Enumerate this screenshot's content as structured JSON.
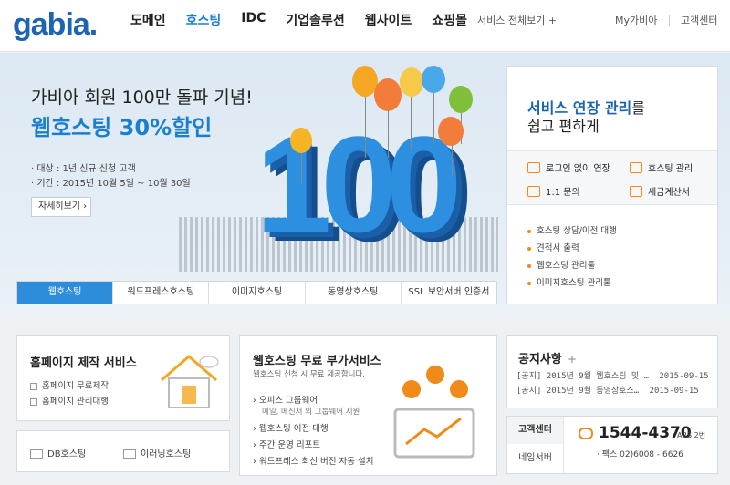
{
  "header": {
    "logo": "gabia.",
    "nav": [
      "도메인",
      "호스팅",
      "IDC",
      "기업솔루션",
      "웹사이트",
      "쇼핑몰"
    ],
    "active_nav": "호스팅",
    "service_all": "서비스 전체보기 +",
    "my_gabia": "My가비아",
    "customer_center": "고객센터"
  },
  "banner": {
    "subtitle": "가비아 회원 100만 돌파 기념!",
    "title": "웹호스팅 30%할인",
    "info": [
      "대상 : 1년 신규 신청 고객",
      "기간 : 2015년 10월 5일 ~ 10월 30일"
    ],
    "detail_button": "자세히보기",
    "big_number": "100",
    "tabs": [
      "웹호스팅",
      "워드프레스호스팅",
      "이미지호스팅",
      "동영상호스팅",
      "SSL 보안서버 인증서"
    ],
    "active_tab": "웹호스팅"
  },
  "service_panel": {
    "title_blue": "서비스 연장 관리",
    "title_suffix": "를",
    "title_line2": "쉽고 편하게",
    "quick_links": [
      "로그인 없이 연장",
      "호스팅 관리",
      "1:1 문의",
      "세금계산서"
    ],
    "links": [
      "호스팅 상담/이전 대행",
      "견적서 출력",
      "웹호스팅 관리툴",
      "이미지호스팅 관리툴"
    ]
  },
  "homepage_card": {
    "title": "홈페이지 제작 서비스",
    "items": [
      "홈페이지 무료제작",
      "홈페이지 관리대행"
    ]
  },
  "mini_links": [
    "DB호스팅",
    "이러닝호스팅"
  ],
  "addon_card": {
    "title": "웹호스팅 무료 부가서비스",
    "desc": "웹호스팅 신청 시 무료 제공합니다.",
    "items": [
      "오피스 그룹웨어",
      "웹호스팅 이전 대행",
      "주간 운영 리포트",
      "워드프레스 최신 버전 자동 설치"
    ],
    "item_sub": "메일, 메신저 외 그룹웨어 지원"
  },
  "notice": {
    "title": "공지사항",
    "plus": "+",
    "items": [
      {
        "text": "[공지] 2015년 9월 웹호스팅 및 …",
        "date": "2015-09-15"
      },
      {
        "text": "[공지] 2015년 9월 동영상호스…",
        "date": "2015-09-15"
      }
    ]
  },
  "support": {
    "label_center": "고객센터",
    "label_name_server": "네임서버",
    "phone": "1544-4370",
    "phone_note": "ARS 2번",
    "fax": "팩스 02)6008 - 6626"
  },
  "colors": {
    "brand": "#1d64b4",
    "accent": "#2e8ddb",
    "orange": "#f08a18"
  }
}
